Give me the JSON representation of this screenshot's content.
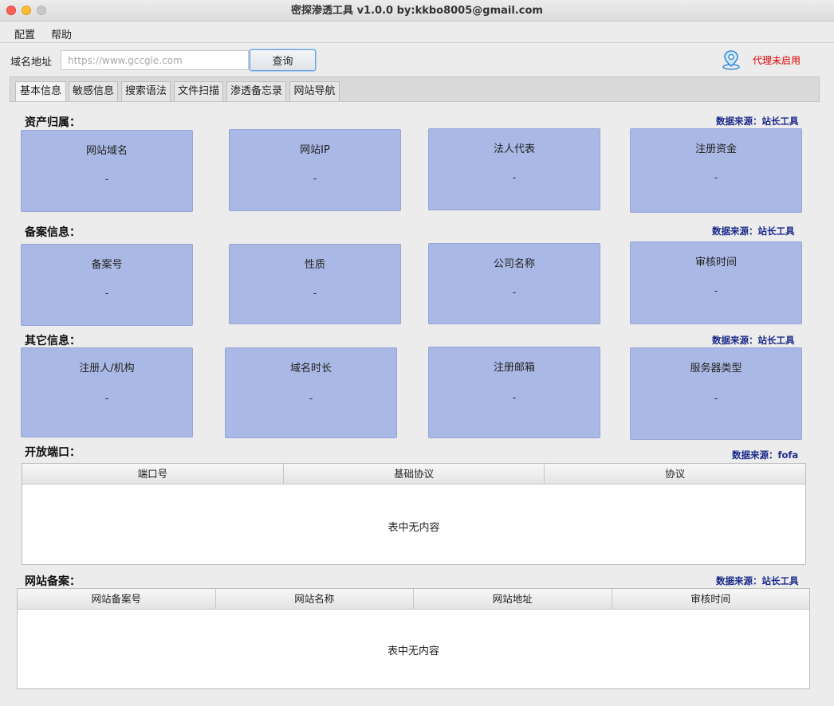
{
  "window": {
    "title": "密探渗透工具  v1.0.0 by:kkbo8005@gmail.com"
  },
  "menu": {
    "items": [
      "配置",
      "帮助"
    ]
  },
  "search": {
    "label": "域名地址",
    "placeholder": "https://www.gccgle.com",
    "value": "",
    "button": "查询"
  },
  "proxy": {
    "status": "代理未启用",
    "icon": "location-pin-icon",
    "color": "#e00000"
  },
  "tabs": [
    "基本信息",
    "敏感信息",
    "搜索语法",
    "文件扫描",
    "渗透备忘录",
    "网站导航"
  ],
  "active_tab": "基本信息",
  "sections": {
    "asset": {
      "title": "资产归属：",
      "source": "数据来源：站长工具",
      "cards": [
        {
          "label": "网站域名",
          "value": "-"
        },
        {
          "label": "网站IP",
          "value": "-"
        },
        {
          "label": "法人代表",
          "value": "-"
        },
        {
          "label": "注册资金",
          "value": "-"
        }
      ]
    },
    "icp": {
      "title": "备案信息：",
      "source": "数据来源：站长工具",
      "cards": [
        {
          "label": "备案号",
          "value": "-"
        },
        {
          "label": "性质",
          "value": "-"
        },
        {
          "label": "公司名称",
          "value": "-"
        },
        {
          "label": "审核时间",
          "value": "-"
        }
      ]
    },
    "other": {
      "title": "其它信息：",
      "source": "数据来源：站长工具",
      "cards": [
        {
          "label": "注册人/机构",
          "value": "-"
        },
        {
          "label": "域名时长",
          "value": "-"
        },
        {
          "label": "注册邮箱",
          "value": "-"
        },
        {
          "label": "服务器类型",
          "value": "-"
        }
      ]
    },
    "ports": {
      "title": "开放端口：",
      "source": "数据来源：fofa",
      "columns": [
        "端口号",
        "基础协议",
        "协议"
      ],
      "empty": "表中无内容"
    },
    "records": {
      "title": "网站备案：",
      "source": "数据来源：站长工具",
      "columns": [
        "网站备案号",
        "网站名称",
        "网站地址",
        "审核时间"
      ],
      "empty": "表中无内容"
    }
  },
  "colors": {
    "card_bg": "#a9b8e4",
    "source_text": "#1a2a8a"
  }
}
